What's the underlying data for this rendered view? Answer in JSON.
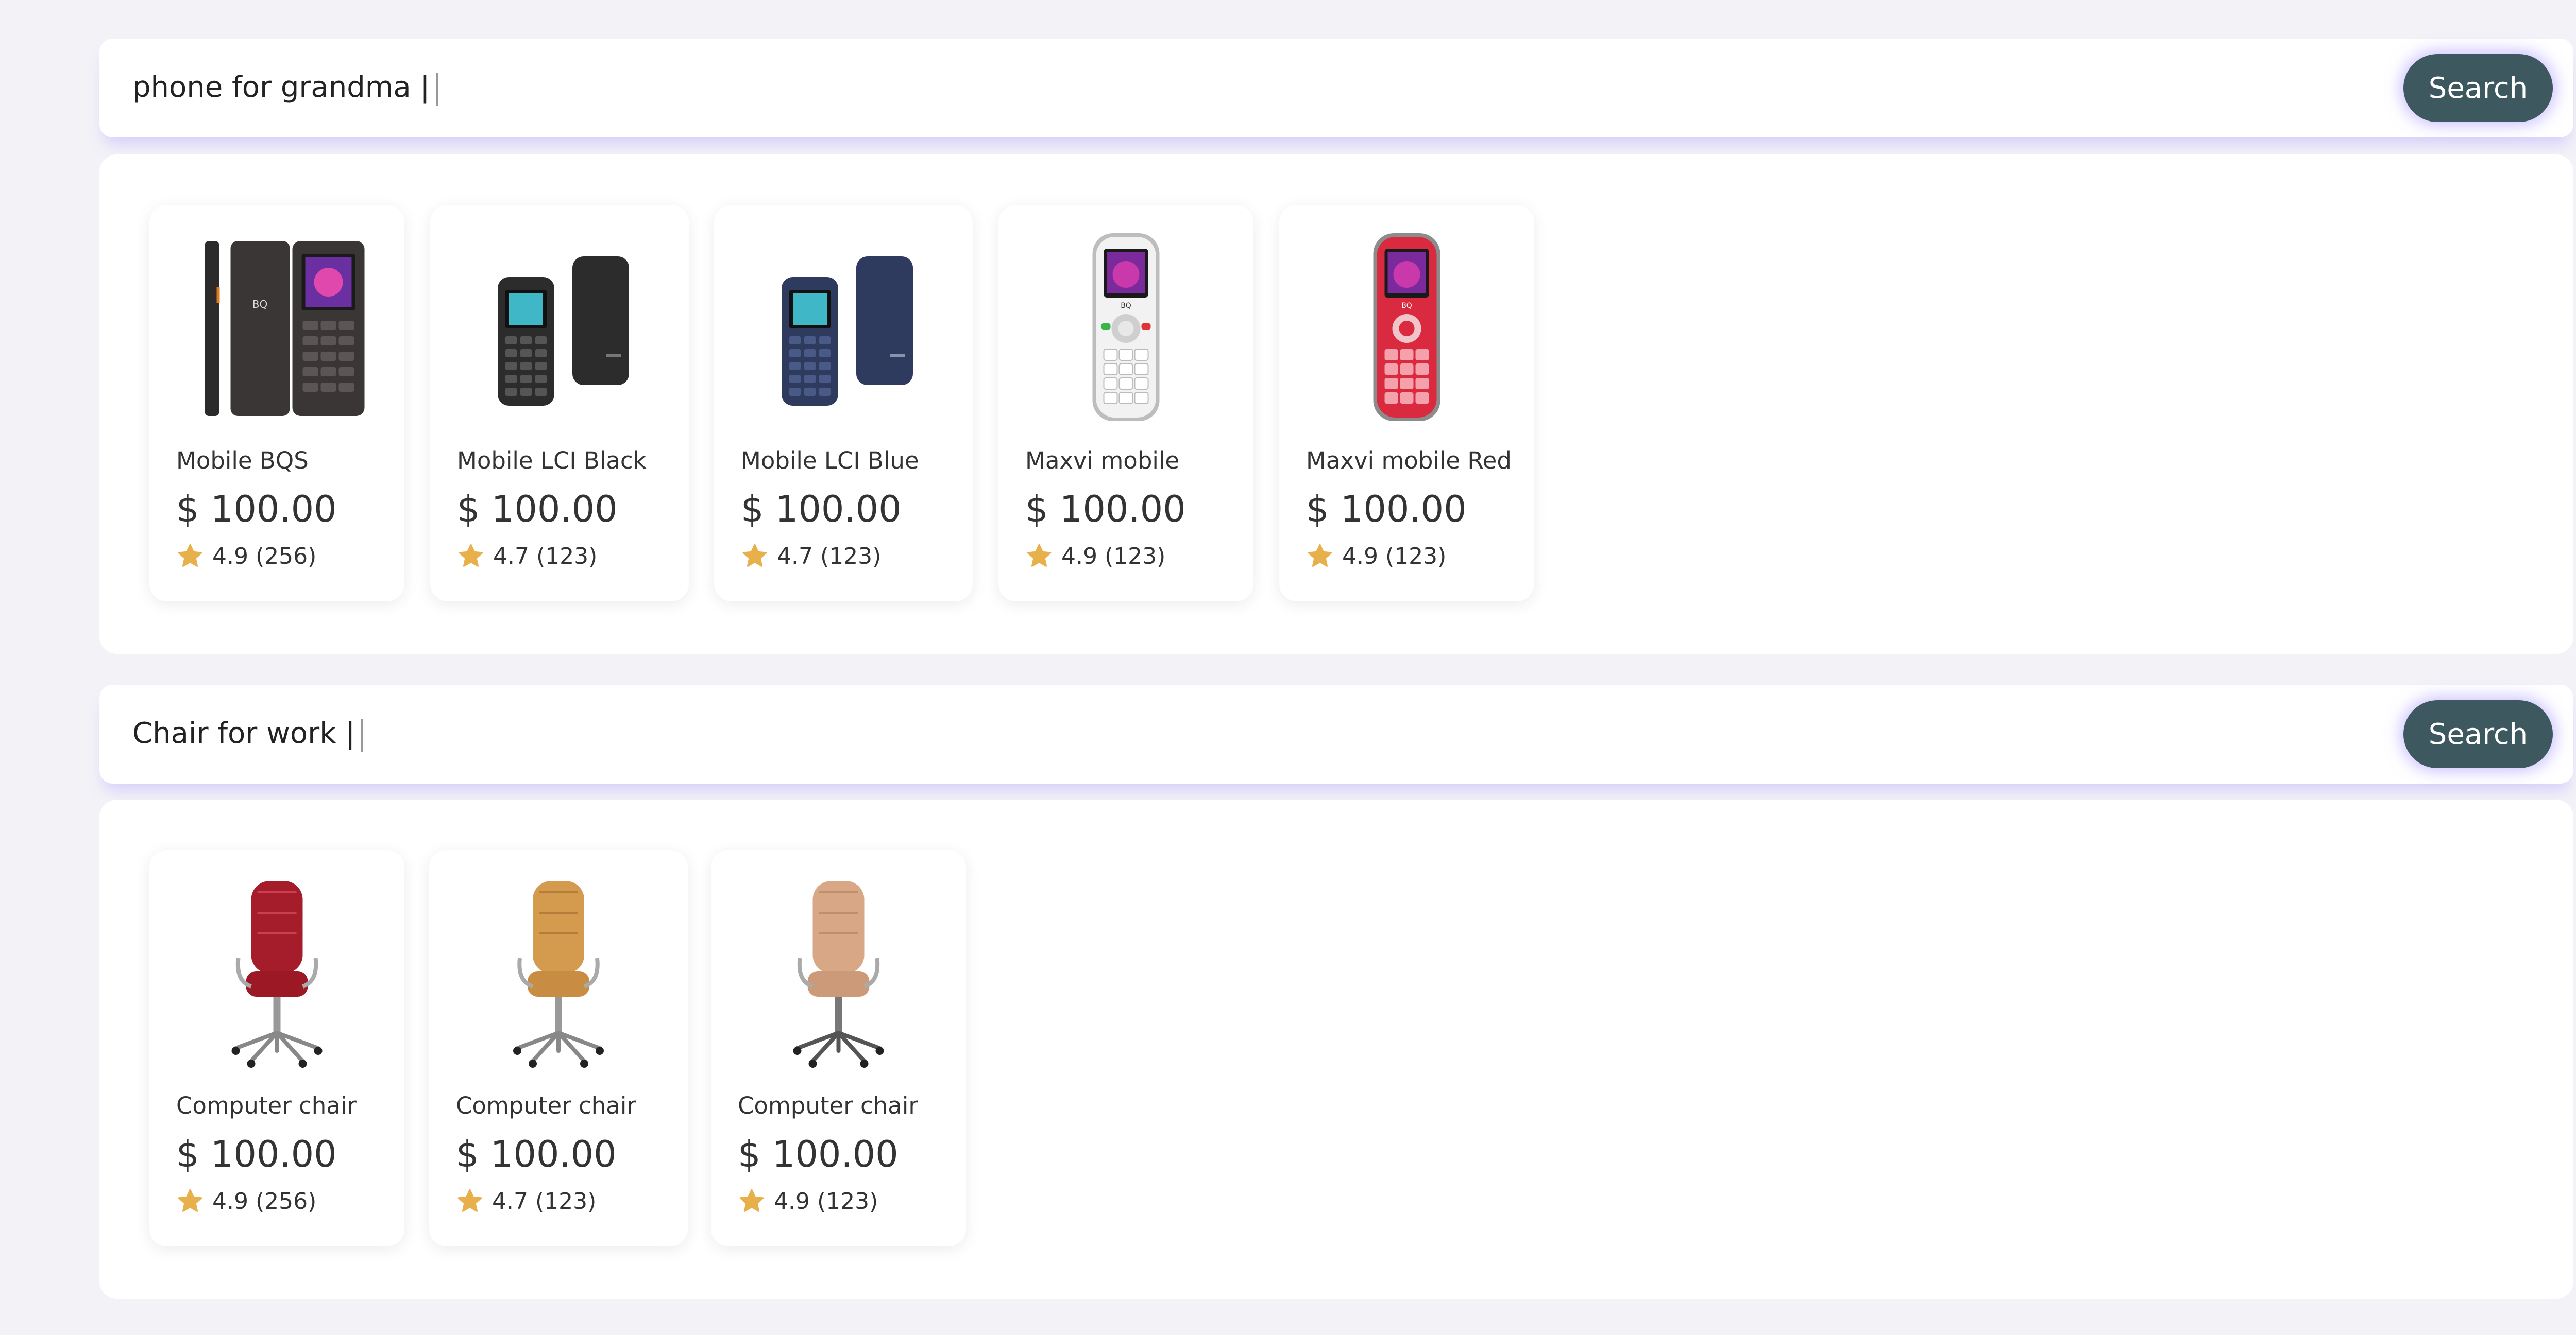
{
  "colors": {
    "accent_button": "#3d585e",
    "star": "#e8b04a",
    "background": "#f3f2f7"
  },
  "searches": [
    {
      "query": "phone for grandma |",
      "button_label": "Search",
      "results": [
        {
          "name": "Mobile BQS",
          "price": "$ 100.00",
          "rating": "4.9 (256)",
          "image": "black-feature-phone-icon"
        },
        {
          "name": "Mobile LCI Black",
          "price": "$ 100.00",
          "rating": "4.7 (123)",
          "image": "black-compact-phone-icon"
        },
        {
          "name": "Mobile LCI Blue",
          "price": "$ 100.00",
          "rating": "4.7 (123)",
          "image": "blue-compact-phone-icon"
        },
        {
          "name": "Maxvi mobile",
          "price": "$ 100.00",
          "rating": "4.9 (123)",
          "image": "white-senior-phone-icon"
        },
        {
          "name": "Maxvi mobile Red",
          "price": "$ 100.00",
          "rating": "4.9 (123)",
          "image": "red-senior-phone-icon"
        }
      ]
    },
    {
      "query": "Chair for work |",
      "button_label": "Search",
      "results": [
        {
          "name": "Computer chair",
          "price": "$ 100.00",
          "rating": "4.9 (256)",
          "image": "red-office-chair-icon"
        },
        {
          "name": "Computer chair",
          "price": "$ 100.00",
          "rating": "4.7 (123)",
          "image": "tan-office-chair-icon"
        },
        {
          "name": "Computer chair",
          "price": "$ 100.00",
          "rating": "4.9 (123)",
          "image": "beige-office-chair-icon"
        }
      ]
    }
  ]
}
